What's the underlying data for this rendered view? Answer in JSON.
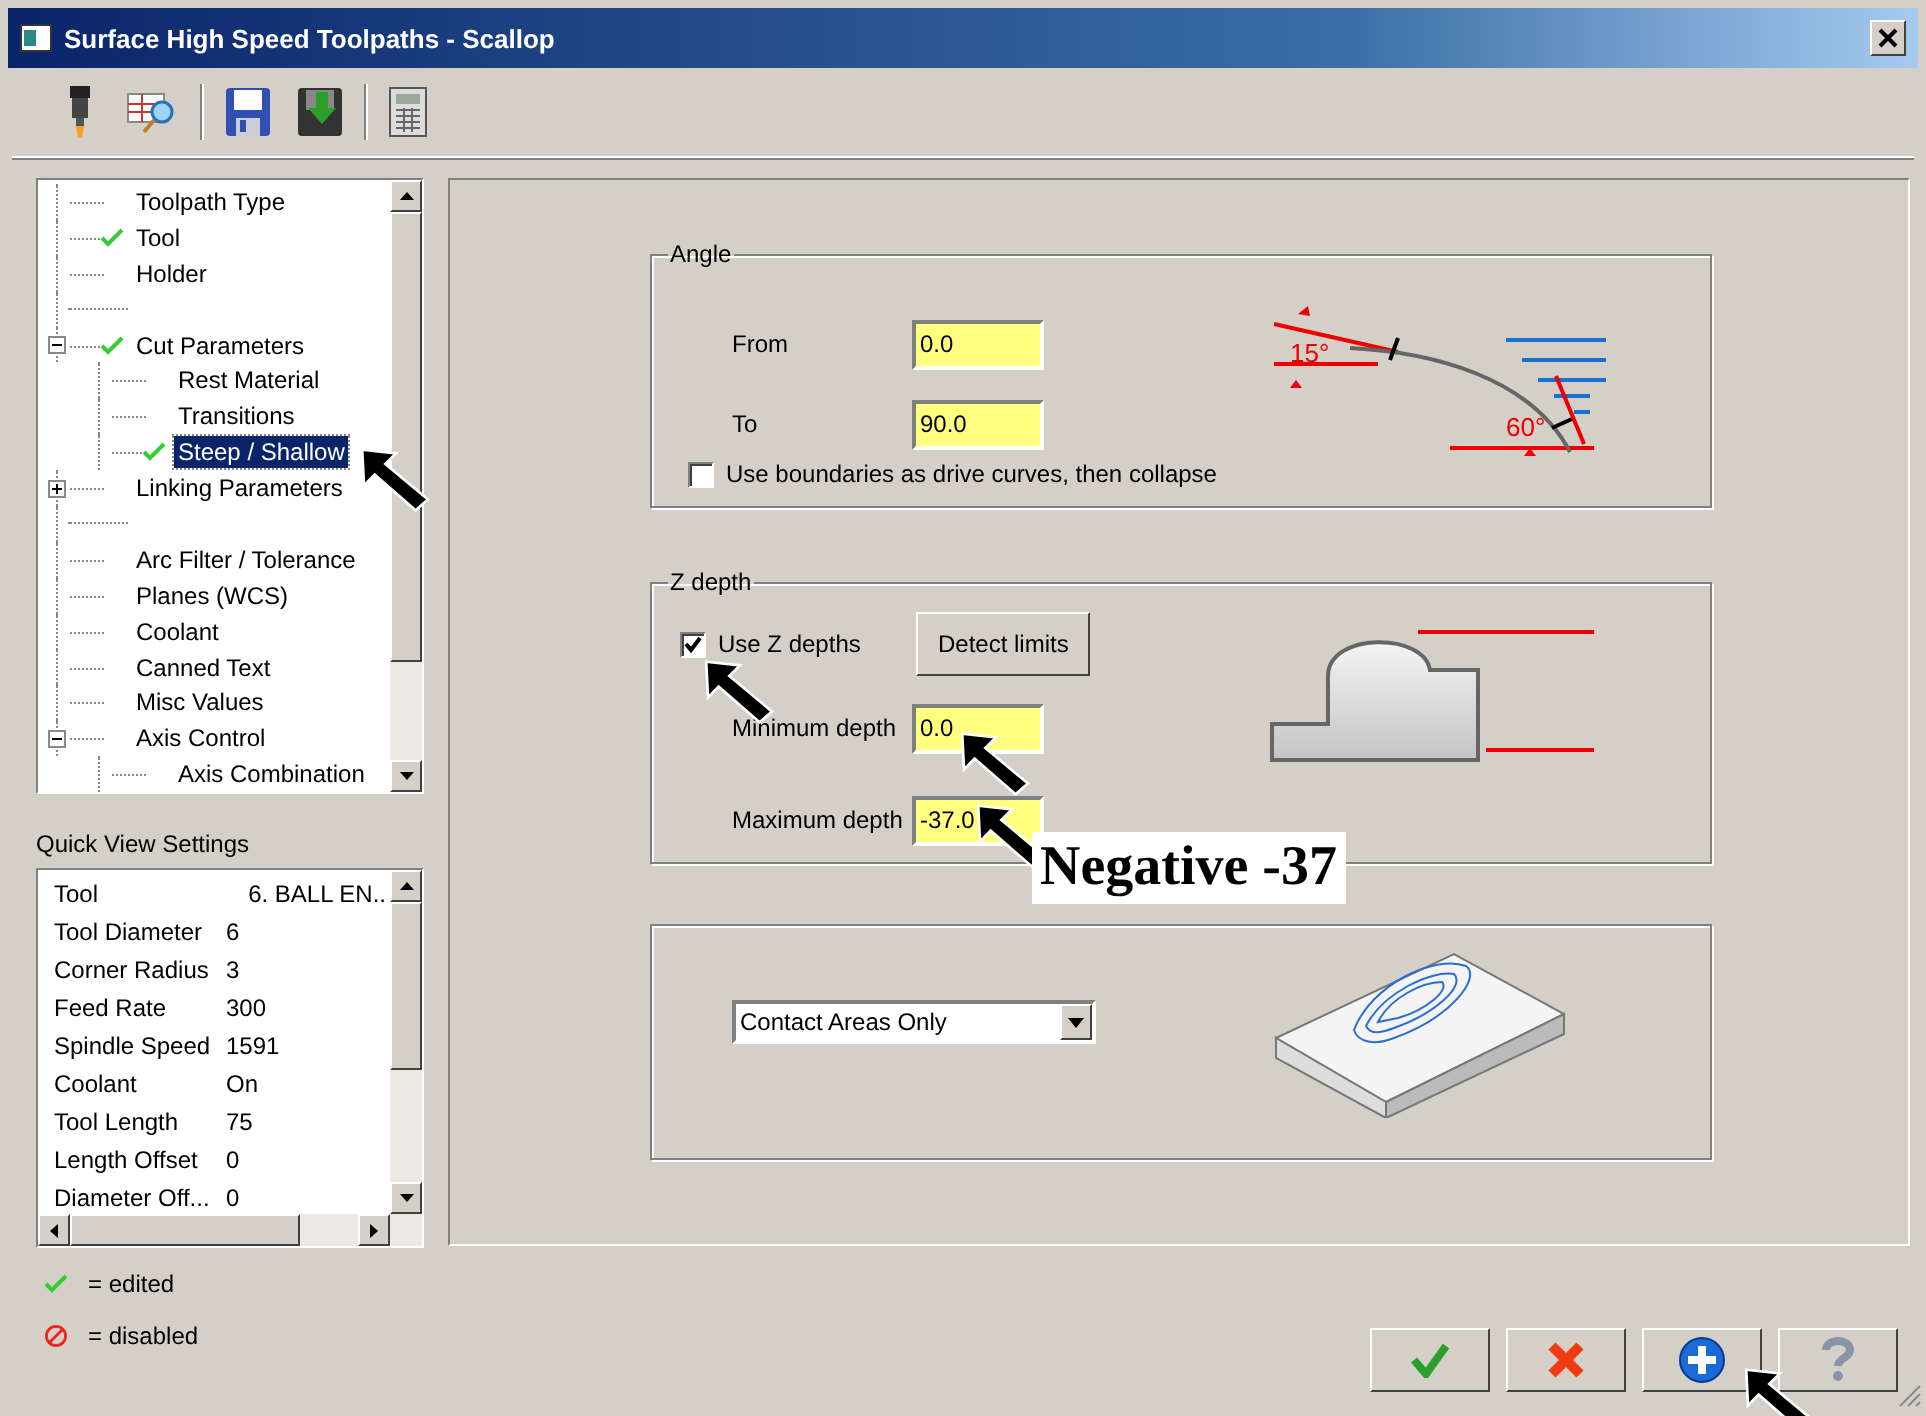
{
  "window": {
    "title": "Surface High Speed Toolpaths - Scallop"
  },
  "tree": [
    {
      "label": "Toolpath Type",
      "edited": false
    },
    {
      "label": "Tool",
      "edited": true
    },
    {
      "label": "Holder",
      "edited": false
    },
    {
      "kind": "blank"
    },
    {
      "label": "Cut Parameters",
      "edited": true,
      "expanded": true,
      "children": [
        {
          "label": "Rest Material",
          "edited": false
        },
        {
          "label": "Transitions",
          "edited": false
        },
        {
          "label": "Steep / Shallow",
          "edited": true,
          "selected": true
        }
      ]
    },
    {
      "label": "Linking Parameters",
      "edited": false,
      "expanded": false
    },
    {
      "kind": "blank"
    },
    {
      "label": "Arc Filter / Tolerance",
      "edited": false
    },
    {
      "label": "Planes (WCS)",
      "edited": false
    },
    {
      "label": "Coolant",
      "edited": false
    },
    {
      "label": "Canned Text",
      "edited": false
    },
    {
      "label": "Misc Values",
      "edited": false
    },
    {
      "label": "Axis Control",
      "edited": false,
      "expanded": true,
      "children": [
        {
          "label": "Axis Combination",
          "edited": false
        }
      ]
    }
  ],
  "quick_view": {
    "title": "Quick View Settings",
    "rows": [
      {
        "name": "Tool",
        "value": "6. BALL EN.."
      },
      {
        "name": "Tool Diameter",
        "value": "6"
      },
      {
        "name": "Corner Radius",
        "value": "3"
      },
      {
        "name": "Feed Rate",
        "value": "300"
      },
      {
        "name": "Spindle Speed",
        "value": "1591"
      },
      {
        "name": "Coolant",
        "value": "On"
      },
      {
        "name": "Tool Length",
        "value": "75"
      },
      {
        "name": "Length Offset",
        "value": "0"
      },
      {
        "name": "Diameter Off...",
        "value": "0"
      }
    ]
  },
  "legend": [
    {
      "kind": "edited",
      "label": "= edited"
    },
    {
      "kind": "disabled",
      "label": "= disabled"
    }
  ],
  "angle": {
    "title": "Angle",
    "from": {
      "label": "From",
      "value": "0.0"
    },
    "to": {
      "label": "To",
      "value": "90.0"
    },
    "use_boundaries": {
      "label": "Use boundaries as drive curves, then collapse",
      "checked": false
    },
    "diagram_labels": [
      "15°",
      "60°"
    ]
  },
  "z_depth": {
    "title": "Z depth",
    "use_z": {
      "label": "Use Z depths",
      "checked": true
    },
    "detect_button": "Detect limits",
    "min": {
      "label": "Minimum depth",
      "value": "0.0"
    },
    "max": {
      "label": "Maximum depth",
      "value": "-37.0"
    }
  },
  "contact": {
    "value": "Contact Areas Only"
  },
  "buttons": [
    {
      "kind": "ok"
    },
    {
      "kind": "cancel"
    },
    {
      "kind": "add"
    },
    {
      "kind": "help"
    }
  ],
  "annotation": {
    "label": "Negative -37"
  }
}
